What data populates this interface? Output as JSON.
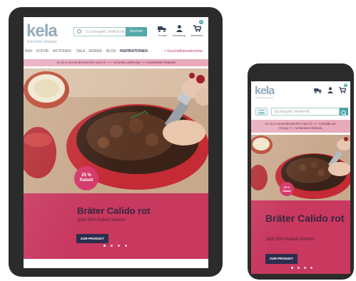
{
  "brand": {
    "logo": "kela",
    "slogan": "Fühl Dich Zuhause.",
    "colors": {
      "logo": "#7f9cb0",
      "accent": "#4aa3a3",
      "promo": "#c8385f",
      "button": "#2c2e4f"
    }
  },
  "search": {
    "placeholder": "Suchbegriff / Artikel-Nr.",
    "button_label": "Suchen"
  },
  "header_icons": [
    {
      "icon": "truck-icon",
      "label": "Kontakt"
    },
    {
      "icon": "user-icon",
      "label": "Anmeldung"
    },
    {
      "icon": "cart-icon",
      "label": "Warenkorb",
      "badge": "0"
    }
  ],
  "nav": [
    {
      "label": "BAD"
    },
    {
      "label": "KÜCHE"
    },
    {
      "label": "AKTIONEN"
    },
    {
      "label": "SALE"
    },
    {
      "label": "SERIEN"
    },
    {
      "label": "BLOG"
    },
    {
      "label": "INSPIRATIONEN"
    },
    {
      "label": "> Geschäftskundenshop"
    }
  ],
  "promo_banner": "Ab 25 € versandkostenfrei nach D +++ schnelle Lieferung +++ kostenlose Retoure",
  "phone_banner": {
    "line1": "Ab 25 € versandkostenfrei nach D +++ schnelle Lie-",
    "line2": "ferung +++ kostenlose Retoure"
  },
  "hero": {
    "discount_badge_line1": "25 %",
    "discount_badge_line2": "Rabatt",
    "title": "Bräter Calido rot",
    "subtitle": "Jetzt 25% Rabatt sichern!",
    "button_label": "ZUM PRODUKT",
    "slides_total": 4,
    "slide_active": 1
  }
}
